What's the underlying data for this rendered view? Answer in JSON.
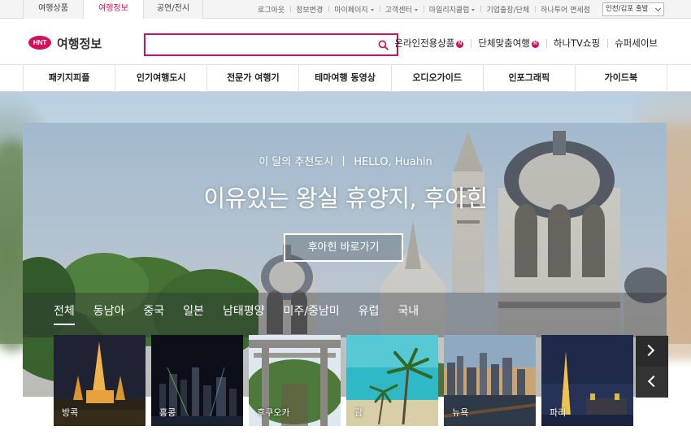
{
  "topbar": {
    "tabs": [
      {
        "label": "여행상품",
        "active": false
      },
      {
        "label": "여행정보",
        "active": true
      },
      {
        "label": "공연/전시",
        "active": false
      }
    ],
    "util_links": [
      "로그아웃",
      "정보변경",
      "마이페이지",
      "고객센터",
      "마일리지클럽",
      "기업출장/단체",
      "하나투어 면세점"
    ],
    "util_dropdowns": [
      "마이페이지",
      "고객센터",
      "마일리지클럽"
    ],
    "departure_select": "인천/김포 출발"
  },
  "header": {
    "logo_text": "HNT",
    "section_title": "여행정보",
    "search": {
      "value": "",
      "placeholder": ""
    },
    "links": [
      {
        "label": "온라인전용상품",
        "badge": "N"
      },
      {
        "label": "단체맞춤여행",
        "badge": "N"
      },
      {
        "label": "하나TV쇼핑",
        "badge": ""
      },
      {
        "label": "슈퍼세이브",
        "badge": ""
      }
    ]
  },
  "nav": {
    "categories": [
      "패키지피플",
      "인기여행도시",
      "전문가 여행기",
      "테마여행 동영상",
      "오디오가이드",
      "인포그래픽",
      "가이드북"
    ]
  },
  "hero": {
    "subtitle_left": "이 달의 추천도시",
    "subtitle_right": "HELLO, Huahin",
    "title": "이유있는 왕실 휴양지, 후아힌",
    "button": "후아힌 바로가기",
    "regions": [
      "전체",
      "동남아",
      "중국",
      "일본",
      "남태평양",
      "미주/중남미",
      "유럽",
      "국내"
    ],
    "active_region": "전체",
    "cities": [
      "방콕",
      "홍콩",
      "후쿠오카",
      "괌",
      "뉴욕",
      "파리"
    ]
  },
  "colors": {
    "brand": "#d5105a"
  }
}
